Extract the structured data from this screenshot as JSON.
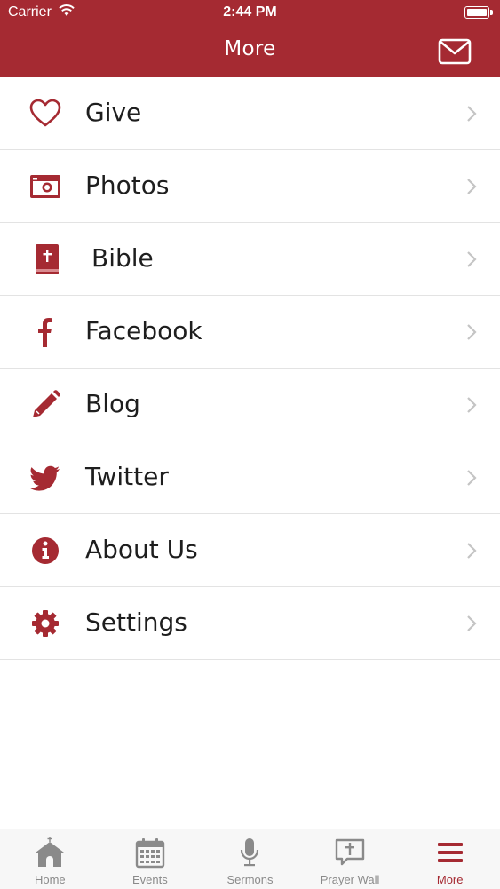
{
  "status_bar": {
    "carrier": "Carrier",
    "time": "2:44 PM"
  },
  "nav": {
    "title": "More"
  },
  "menu": [
    {
      "label": "Give",
      "icon": "heart-icon"
    },
    {
      "label": "Photos",
      "icon": "camera-icon"
    },
    {
      "label": "Bible",
      "icon": "bible-icon"
    },
    {
      "label": "Facebook",
      "icon": "facebook-icon"
    },
    {
      "label": "Blog",
      "icon": "pencil-icon"
    },
    {
      "label": "Twitter",
      "icon": "twitter-icon"
    },
    {
      "label": "About Us",
      "icon": "info-icon"
    },
    {
      "label": "Settings",
      "icon": "gear-icon"
    }
  ],
  "tabs": [
    {
      "label": "Home",
      "icon": "church-icon"
    },
    {
      "label": "Events",
      "icon": "calendar-icon"
    },
    {
      "label": "Sermons",
      "icon": "microphone-icon"
    },
    {
      "label": "Prayer Wall",
      "icon": "prayer-bubble-icon"
    },
    {
      "label": "More",
      "icon": "menu-icon",
      "active": true
    }
  ],
  "colors": {
    "accent": "#a52a32",
    "tab_inactive": "#8a8a8a",
    "separator": "#e3e3e3"
  }
}
